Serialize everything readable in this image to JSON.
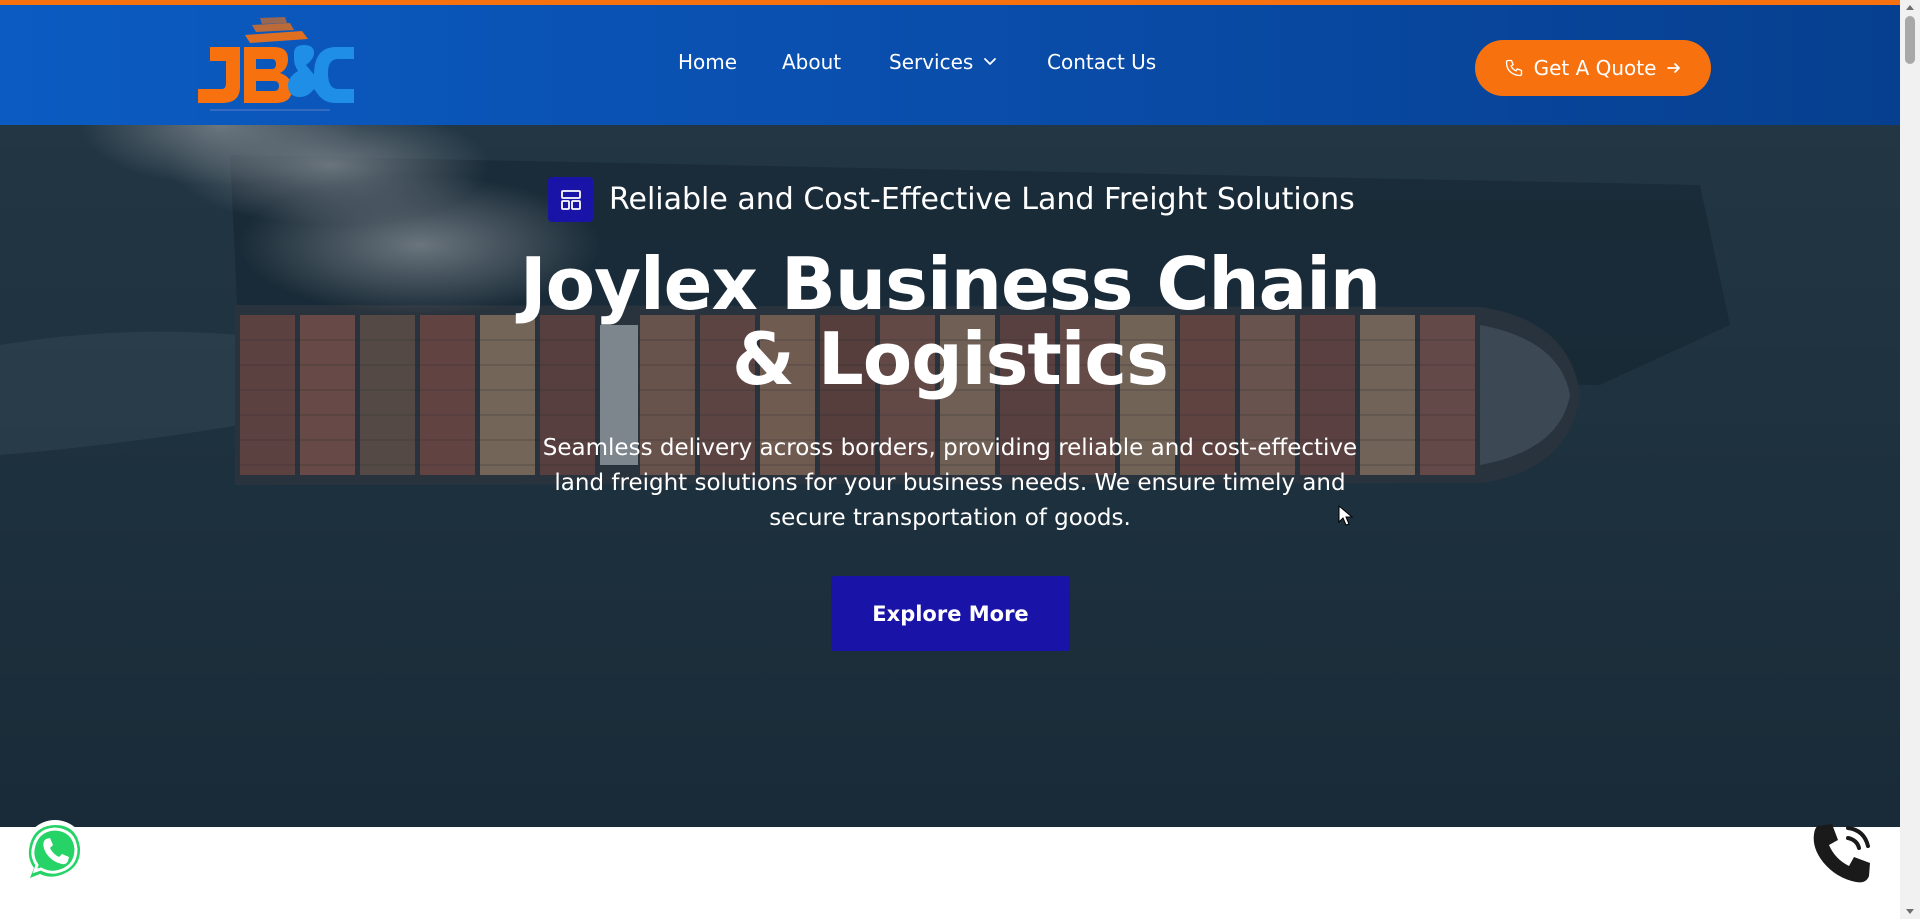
{
  "brand": {
    "logo_text": "JB&C",
    "logo_subtext": "Joylex Business Chain & Logistics",
    "colors": {
      "accent_orange": "#f7720f",
      "header_blue": "#0a4fae",
      "cta_indigo": "#1a13a8",
      "whatsapp_green": "#25d366"
    }
  },
  "nav": {
    "items": [
      {
        "label": "Home"
      },
      {
        "label": "About"
      },
      {
        "label": "Services",
        "icon": "chevron-down-icon"
      },
      {
        "label": "Contact Us"
      }
    ],
    "quote_button": {
      "label": "Get A Quote",
      "left_icon": "phone-icon",
      "right_icon": "arrow-right-icon"
    }
  },
  "hero": {
    "eyebrow": {
      "icon": "layout-grid-icon",
      "text": "Reliable and Cost-Effective Land Freight Solutions"
    },
    "title_line1": "Joylex Business Chain",
    "title_line2": "& Logistics",
    "description": "Seamless delivery across borders, providing reliable and cost-effective land freight solutions for your business needs. We ensure timely and secure transportation of goods.",
    "cta_label": "Explore More",
    "background": "container-ship-aerial"
  },
  "floating": {
    "whatsapp_icon": "whatsapp-icon",
    "phone_icon": "phone-call-icon"
  }
}
